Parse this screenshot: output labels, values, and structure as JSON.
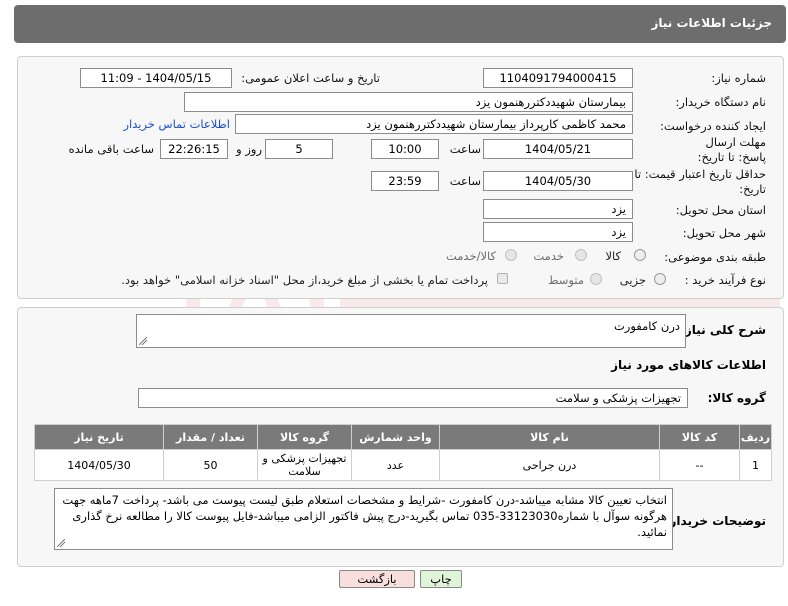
{
  "header": {
    "title": "جزئیات اطلاعات نیاز"
  },
  "form": {
    "need_number_label": "شماره نیاز:",
    "need_number": "1104091794000415",
    "announce_label": "تاریخ و ساعت اعلان عمومی:",
    "announce_value": "1404/05/15 - 11:09",
    "buyer_org_label": "نام دستگاه خریدار:",
    "buyer_org": "بیمارستان شهیددکتررهنمون یزد",
    "requester_label": "ایجاد کننده درخواست:",
    "requester": "محمد کاظمی کارپرداز بیمارستان شهیددکتررهنمون یزد",
    "contact_link": "اطلاعات تماس خریدار",
    "deadline_label": "مهلت ارسال پاسخ: تا تاریخ:",
    "deadline_date": "1404/05/21",
    "time_label": "ساعت",
    "deadline_time": "10:00",
    "days_value": "5",
    "days_label": "روز و",
    "remaining_time": "22:26:15",
    "remaining_label": "ساعت باقی مانده",
    "price_validity_label": "حداقل تاریخ اعتبار قیمت: تا تاریخ:",
    "price_date": "1404/05/30",
    "price_time": "23:59",
    "province_label": "استان محل تحویل:",
    "province": "یزد",
    "city_label": "شهر محل تحویل:",
    "city": "یزد",
    "category_label": "طبقه بندی موضوعی:",
    "category_options": [
      "کالا",
      "خدمت",
      "کالا/خدمت"
    ],
    "process_label": "نوع فرآیند خرید :",
    "process_options": [
      "جزیی",
      "متوسط"
    ],
    "payment_note": "پرداخت تمام یا بخشی از مبلغ خرید،از محل \"اسناد خزانه اسلامی\" خواهد بود."
  },
  "details": {
    "summary_label": "شرح کلی نیاز:",
    "summary": "درن کامفورت",
    "goods_info_title": "اطلاعات کالاهای مورد نیاز",
    "goods_group_label": "گروه کالا:",
    "goods_group": "تجهیزات پزشکی و سلامت",
    "table": {
      "headers": [
        "ردیف",
        "کد کالا",
        "نام کالا",
        "واحد شمارش",
        "گروه کالا",
        "تعداد / مقدار",
        "تاریخ نیاز"
      ],
      "rows": [
        [
          "1",
          "--",
          "درن جراحی",
          "عدد",
          "تجهیزات پزشکی و سلامت",
          "50",
          "1404/05/30"
        ]
      ]
    },
    "buyer_notes_label": "توضیحات خریدار:",
    "buyer_notes": "انتخاب تعیین کالا مشابه میباشد-درن کامفورت -شرایط و مشخصات استعلام طبق لیست پیوست می باشد- پرداخت 7ماهه جهت هرگونه سوآل با شماره33123030-035 تماس بگیرید-درج پیش فاکتور الزامی میباشد-فایل پیوست کالا را مطالعه نرخ گذاری نمائید."
  },
  "buttons": {
    "print": "چاپ",
    "back": "بازگشت"
  },
  "colors": {
    "header_bg": "#6d6d6d",
    "table_header_bg": "#7a7a7a",
    "link": "#1a4fd0",
    "print_bg": "#dff5d8",
    "back_bg": "#f9dede"
  }
}
